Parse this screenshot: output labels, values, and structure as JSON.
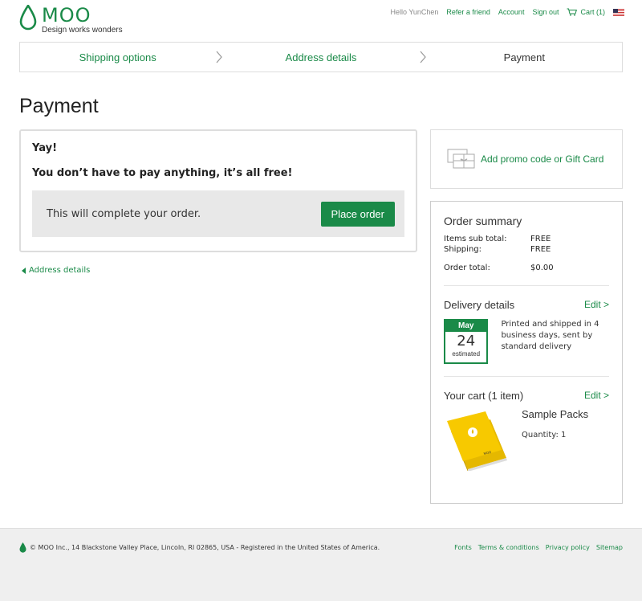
{
  "header": {
    "logo_text": "MOO",
    "tagline": "Design works wonders",
    "greeting": "Hello YunChen",
    "refer": "Refer a friend",
    "account": "Account",
    "signout": "Sign out",
    "cart": "Cart (1)"
  },
  "steps": [
    "Shipping options",
    "Address details",
    "Payment"
  ],
  "page_title": "Payment",
  "payment": {
    "yay": "Yay!",
    "free_msg": "You don’t have to pay anything, it’s all free!",
    "complete_text": "This will complete your order.",
    "place_order": "Place order"
  },
  "back_link": "Address details",
  "promo": "Add promo code or Gift Card",
  "summary": {
    "title": "Order summary",
    "items_label": "Items sub total:",
    "items_value": "FREE",
    "shipping_label": "Shipping:",
    "shipping_value": "FREE",
    "total_label": "Order total:",
    "total_value": "$0.00",
    "delivery_title": "Delivery details",
    "edit": "Edit >",
    "cal_month": "May",
    "cal_day": "24",
    "cal_est": "estimated",
    "delivery_text": "Printed and shipped in 4 business days, sent by standard delivery",
    "cart_title": "Your cart (1 item)",
    "product_name": "Sample Packs",
    "product_qty": "Quantity: 1"
  },
  "footer": {
    "address": "© MOO Inc., 14 Blackstone Valley Place, Lincoln, RI 02865, USA - Registered in the United States of America.",
    "links": [
      "Fonts",
      "Terms & conditions",
      "Privacy policy",
      "Sitemap"
    ]
  },
  "colors": {
    "brand": "#1a8a48",
    "footer_bg": "#efefef"
  }
}
